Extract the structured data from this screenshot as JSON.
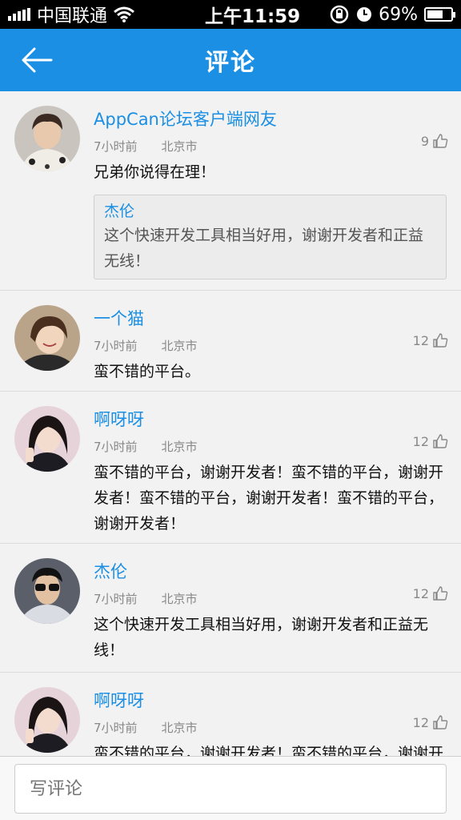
{
  "status_bar": {
    "carrier": "中国联通",
    "time": "上午11:59",
    "battery": "69%",
    "battery_level": 0.69
  },
  "header": {
    "title": "评论",
    "back_icon": "arrow-left-icon"
  },
  "comments": [
    {
      "user": "AppCan论坛客户端网友",
      "time": "7小时前",
      "location": "北京市",
      "likes": "9",
      "text": "兄弟你说得在理！",
      "quote": {
        "name": "杰伦",
        "text": "这个快速开发工具相当好用，谢谢开发者和正益无线！"
      }
    },
    {
      "user": "一个猫",
      "time": "7小时前",
      "location": "北京市",
      "likes": "12",
      "text": "蛮不错的平台。"
    },
    {
      "user": "啊呀呀",
      "time": "7小时前",
      "location": "北京市",
      "likes": "12",
      "text": "蛮不错的平台，谢谢开发者！蛮不错的平台，谢谢开发者！蛮不错的平台，谢谢开发者！蛮不错的平台，谢谢开发者！"
    },
    {
      "user": "杰伦",
      "time": "7小时前",
      "location": "北京市",
      "likes": "12",
      "text": "这个快速开发工具相当好用，谢谢开发者和正益无线！"
    },
    {
      "user": "啊呀呀",
      "time": "7小时前",
      "location": "北京市",
      "likes": "12",
      "text": "蛮不错的平台，谢谢开发者！蛮不错的平台，谢谢开发者！"
    }
  ],
  "composer": {
    "placeholder": "写评论"
  }
}
